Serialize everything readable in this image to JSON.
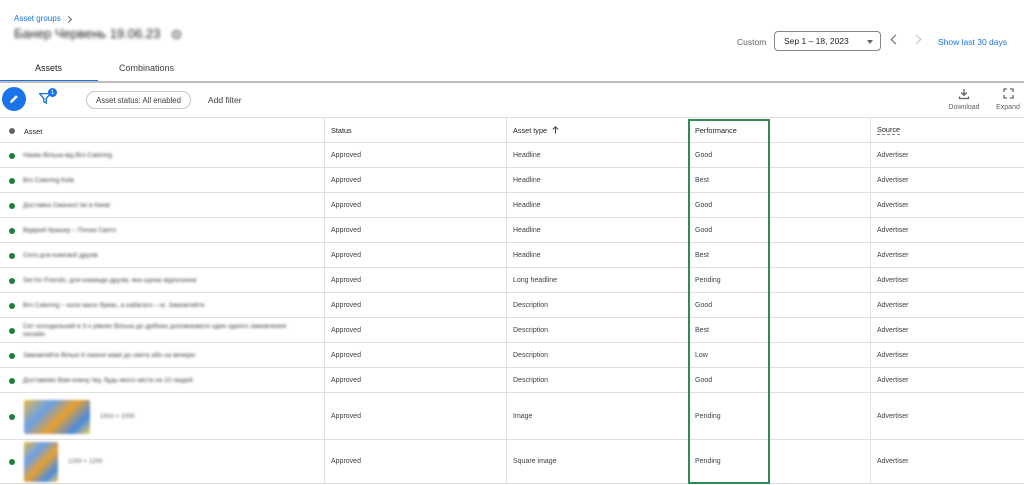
{
  "header": {
    "breadcrumb": "Asset groups",
    "title": "Банер Червень 19.06.23",
    "date_label": "Custom",
    "date_range": "Sep 1 – 18, 2023",
    "show_last": "Show last 30 days"
  },
  "tabs": [
    {
      "label": "Assets",
      "active": true
    },
    {
      "label": "Combinations",
      "active": false
    }
  ],
  "toolbar": {
    "filter_count": "1",
    "status_chip": "Asset status: All enabled",
    "add_filter": "Add filter",
    "download_label": "Download",
    "expand_label": "Expand"
  },
  "table": {
    "columns": [
      "Asset",
      "Status",
      "Asset type",
      "Performance",
      "Source"
    ],
    "rows": [
      {
        "asset": "Назва Вільна від Bro Catering",
        "status": "Approved",
        "type": "Headline",
        "performance": "Good",
        "source": "Advertiser"
      },
      {
        "asset": "Bro Catering Київ",
        "status": "Approved",
        "type": "Headline",
        "performance": "Best",
        "source": "Advertiser"
      },
      {
        "asset": "Доставка Смачної їжі в Києві",
        "status": "Approved",
        "type": "Headline",
        "performance": "Good",
        "source": "Advertiser"
      },
      {
        "asset": "Відкрий Крашку – Почни Свято",
        "status": "Approved",
        "type": "Headline",
        "performance": "Good",
        "source": "Advertiser"
      },
      {
        "asset": "Сети для компанії друзів",
        "status": "Approved",
        "type": "Headline",
        "performance": "Best",
        "source": "Advertiser"
      },
      {
        "asset": "Set for Friends: для команди друзів, яка шукає відпочинок",
        "status": "Approved",
        "type": "Long headline",
        "performance": "Pending",
        "source": "Advertiser"
      },
      {
        "asset": "Bro Catering – коли мало буває, а набагато – ні. Замовляйте",
        "status": "Approved",
        "type": "Description",
        "performance": "Good",
        "source": "Advertiser"
      },
      {
        "asset": "Сет холодильний в 3-х рівнях Вільна до дрібних доповнювати один одного замовлення онлайн",
        "status": "Approved",
        "type": "Description",
        "performance": "Best",
        "source": "Advertiser"
      },
      {
        "asset": "Замовляйте Вільні й смачні мамі до свята або на вечерю",
        "status": "Approved",
        "type": "Description",
        "performance": "Low",
        "source": "Advertiser"
      },
      {
        "asset": "Доставимо Вам кожну їжу, будь-якого міста на 10 людей",
        "status": "Approved",
        "type": "Description",
        "performance": "Good",
        "source": "Advertiser"
      },
      {
        "asset": "1910 × 1000",
        "status": "Approved",
        "type": "Image",
        "performance": "Pending",
        "source": "Advertiser"
      },
      {
        "asset": "1200 × 1200",
        "status": "Approved",
        "type": "Square image",
        "performance": "Pending",
        "source": "Advertiser"
      }
    ]
  },
  "colors": {
    "accent": "#1a73e8",
    "enabled_dot": "#188038",
    "highlight_box": "#2e8b57"
  },
  "icons": [
    "chevron-right-icon",
    "info-icon",
    "dropdown-caret-icon",
    "chevron-left-icon",
    "pencil-icon",
    "filter-icon",
    "arrow-up-icon",
    "download-icon",
    "expand-icon"
  ]
}
